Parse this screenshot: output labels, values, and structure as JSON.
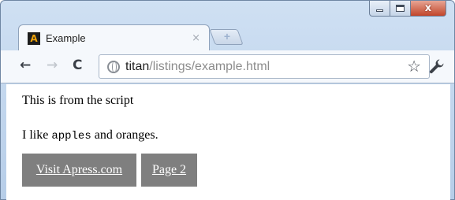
{
  "tab": {
    "title": "Example",
    "close": "×",
    "favicon_letter": "A"
  },
  "new_tab": {
    "symbol": "+"
  },
  "window_controls": {
    "close": "x"
  },
  "toolbar": {
    "back": "←",
    "forward": "→",
    "reload": "C",
    "url_host": "titan",
    "url_path": "/listings/example.html",
    "star": "☆"
  },
  "page": {
    "line1": "This is from the script",
    "line2_before": "I like ",
    "line2_code": "apples",
    "line2_after": " and oranges.",
    "links": [
      "Visit Apress.com",
      "Page 2"
    ]
  },
  "colors": {
    "window_frame": "#b6cde8",
    "close_button": "#c2452a",
    "link_button_bg": "#7f7f7f",
    "favicon_letter": "#f0a30a"
  },
  "icons": [
    "favicon-a-icon",
    "close-icon",
    "new-tab-icon",
    "back-arrow-icon",
    "forward-arrow-icon",
    "reload-icon",
    "globe-icon",
    "star-icon",
    "wrench-icon",
    "minimize-icon",
    "maximize-icon"
  ]
}
